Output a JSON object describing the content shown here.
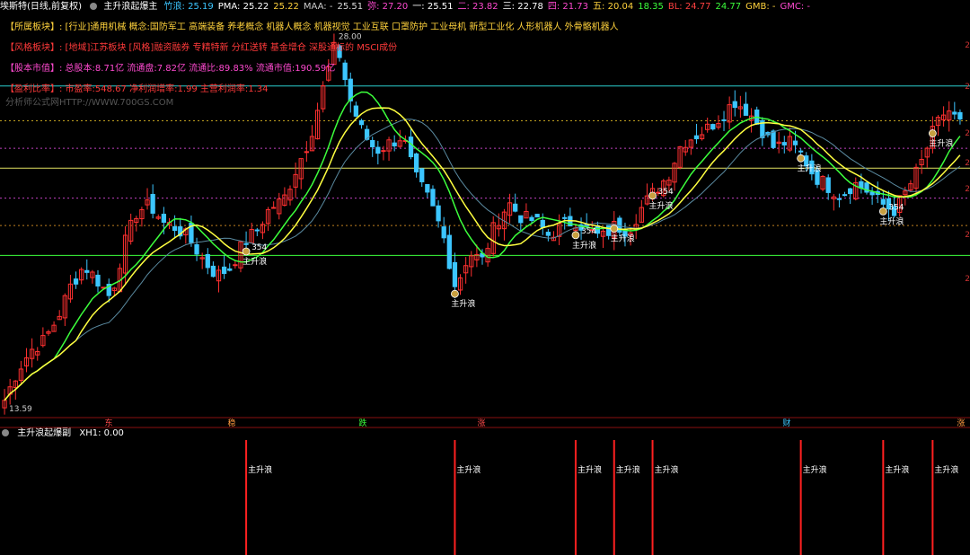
{
  "header": {
    "stock_name": "埃斯特(日线,前复权)",
    "indicator_name": "主升浪起爆主",
    "items": [
      {
        "label": "竹浪:",
        "value": "25.19",
        "color": "#3cc6ff"
      },
      {
        "label": "PMA:",
        "value": "25.22",
        "color": "#ffffff"
      },
      {
        "label": "",
        "value": "25.22",
        "color": "#ffd23c"
      },
      {
        "label": "MAA:",
        "value": "-",
        "color": "#cccccc"
      },
      {
        "label": "",
        "value": "25.51",
        "color": "#dddddd"
      },
      {
        "label": "弥:",
        "value": "27.20",
        "color": "#ff4ad0"
      },
      {
        "label": "一:",
        "value": "25.51",
        "color": "#ffffff"
      },
      {
        "label": "二:",
        "value": "23.82",
        "color": "#ff4ad0"
      },
      {
        "label": "三:",
        "value": "22.78",
        "color": "#ffffff"
      },
      {
        "label": "四:",
        "value": "21.73",
        "color": "#ff4ad0"
      },
      {
        "label": "五:",
        "value": "20.04",
        "color": "#ffd23c"
      },
      {
        "label": "",
        "value": "18.35",
        "color": "#3cff3c"
      },
      {
        "label": "BL:",
        "value": "24.77",
        "color": "#ff4040"
      },
      {
        "label": "",
        "value": "24.77",
        "color": "#3cff3c"
      },
      {
        "label": "GMB:",
        "value": "-",
        "color": "#ffd23c"
      },
      {
        "label": "GMC:",
        "value": "-",
        "color": "#ff4ad0"
      }
    ]
  },
  "info_lines": [
    {
      "text": "【所属板块】: [行业]通用机械 概念:国防军工 高端装备 养老概念 机器人概念 机器视觉 工业互联 口罩防护 工业母机 新型工业化 人形机器人 外骨骼机器人",
      "color": "#ffd23c"
    },
    {
      "text": "【风格板块】: [地域]江苏板块 [风格]融资融券 专精特新 分红送转 基金增仓 深股通标的 MSCI成份",
      "color": "#ff3a3a"
    },
    {
      "text": "【股本市值】: 总股本:8.71亿 流通盘:7.82亿 流通比:89.83% 流通市值:190.59亿",
      "color": "#ff4ad0"
    },
    {
      "text": "【盈利比率】: 市盈率:548.67 净利润增率:1.99 主营利润率:1.34",
      "color": "#ff3a3a"
    }
  ],
  "watermark": "分析师公式网HTTP://WWW.700GS.COM",
  "price_marks": {
    "high": "28.00",
    "low": "13.59"
  },
  "signal_labels": {
    "main_wave": "主升浪",
    "code": "354"
  },
  "calendar_tags": [
    {
      "text": "东",
      "color": "#ff4a4a"
    },
    {
      "text": "稳",
      "color": "#ff9a40"
    },
    {
      "text": "跌",
      "color": "#3cff3c"
    },
    {
      "text": "涨",
      "color": "#ff4a4a"
    },
    {
      "text": "财",
      "color": "#3cc6ff"
    },
    {
      "text": "涨",
      "color": "#ff9a40"
    }
  ],
  "sub_header": {
    "name": "主升浪起爆副",
    "indicator": "XH1: 0.00"
  },
  "right_axis": [
    "2",
    "2",
    "2",
    "2",
    "2",
    "2",
    "2"
  ],
  "colors": {
    "up": "#ff3030",
    "down": "#3cc6ff",
    "ma_yellow": "#ffff40",
    "ma_green": "#3cff3c",
    "ma_faint": "#5a8aa0"
  },
  "chart_data": {
    "type": "candlestick",
    "price_range": [
      13.0,
      29.0
    ],
    "level_lines": [
      {
        "y": 26.2,
        "color": "#2ad0d0",
        "style": "solid"
      },
      {
        "y": 24.8,
        "color": "#c0a020",
        "style": "dashed"
      },
      {
        "y": 23.7,
        "color": "#c040c0",
        "style": "dashed"
      },
      {
        "y": 22.9,
        "color": "#e0e060",
        "style": "solid"
      },
      {
        "y": 21.7,
        "color": "#c040c0",
        "style": "dashed"
      },
      {
        "y": 20.6,
        "color": "#c08020",
        "style": "dashed"
      },
      {
        "y": 19.4,
        "color": "#3cff3c",
        "style": "solid"
      }
    ],
    "path_points": [
      13.59,
      14.8,
      15.6,
      16.0,
      16.9,
      18.2,
      19.0,
      18.4,
      17.7,
      19.8,
      21.2,
      21.4,
      20.7,
      20.5,
      20.0,
      19.2,
      18.6,
      18.9,
      19.9,
      20.4,
      21.3,
      21.6,
      22.9,
      24.1,
      26.1,
      28.0,
      25.7,
      24.3,
      23.6,
      23.9,
      24.2,
      22.5,
      21.6,
      20.3,
      18.1,
      19.5,
      19.2,
      20.7,
      21.5,
      20.9,
      20.8,
      20.2,
      20.6,
      20.8,
      20.4,
      20.1,
      20.6,
      20.4,
      21.3,
      22.0,
      22.6,
      23.9,
      24.2,
      24.5,
      25.0,
      25.6,
      25.2,
      24.5,
      23.7,
      24.0,
      23.5,
      22.6,
      22.2,
      21.8,
      22.3,
      22.0,
      21.5,
      21.2,
      22.0,
      23.0,
      24.4,
      25.3,
      24.7
    ],
    "main_wave_markers_index": [
      18,
      34,
      43,
      46,
      49,
      60,
      66,
      70
    ]
  }
}
